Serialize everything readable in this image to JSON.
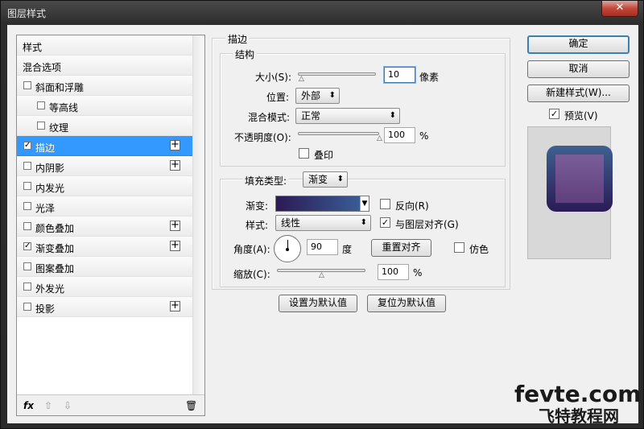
{
  "window": {
    "title": "图层样式",
    "close": "✕"
  },
  "styles_list": {
    "header": "样式",
    "items": [
      {
        "label": "混合选项",
        "checkbox": false,
        "checked": false,
        "plus": false,
        "indent": 0,
        "selected": false
      },
      {
        "label": "斜面和浮雕",
        "checkbox": true,
        "checked": false,
        "plus": false,
        "indent": 0,
        "selected": false
      },
      {
        "label": "等高线",
        "checkbox": true,
        "checked": false,
        "plus": false,
        "indent": 1,
        "selected": false
      },
      {
        "label": "纹理",
        "checkbox": true,
        "checked": false,
        "plus": false,
        "indent": 1,
        "selected": false
      },
      {
        "label": "描边",
        "checkbox": true,
        "checked": true,
        "plus": true,
        "indent": 0,
        "selected": true
      },
      {
        "label": "内阴影",
        "checkbox": true,
        "checked": false,
        "plus": true,
        "indent": 0,
        "selected": false
      },
      {
        "label": "内发光",
        "checkbox": true,
        "checked": false,
        "plus": false,
        "indent": 0,
        "selected": false
      },
      {
        "label": "光泽",
        "checkbox": true,
        "checked": false,
        "plus": false,
        "indent": 0,
        "selected": false
      },
      {
        "label": "颜色叠加",
        "checkbox": true,
        "checked": false,
        "plus": true,
        "indent": 0,
        "selected": false
      },
      {
        "label": "渐变叠加",
        "checkbox": true,
        "checked": true,
        "plus": true,
        "indent": 0,
        "selected": false
      },
      {
        "label": "图案叠加",
        "checkbox": true,
        "checked": false,
        "plus": false,
        "indent": 0,
        "selected": false
      },
      {
        "label": "外发光",
        "checkbox": true,
        "checked": false,
        "plus": false,
        "indent": 0,
        "selected": false
      },
      {
        "label": "投影",
        "checkbox": true,
        "checked": false,
        "plus": true,
        "indent": 0,
        "selected": false
      }
    ],
    "footer": {
      "fx": "fx",
      "up": "⇧",
      "down": "⇩",
      "trash": "🗑"
    }
  },
  "stroke": {
    "title": "描边",
    "structure": {
      "title": "结构",
      "size_label": "大小(S):",
      "size_value": "10",
      "size_unit": "像素",
      "size_level": 0.04,
      "position_label": "位置:",
      "position_value": "外部",
      "blend_label": "混合模式:",
      "blend_value": "正常",
      "opacity_label": "不透明度(O):",
      "opacity_value": "100",
      "opacity_unit": "%",
      "opacity_level": 1.0,
      "overprint_label": "叠印",
      "overprint_checked": false
    },
    "fill": {
      "type_label": "填充类型:",
      "type_value": "渐变",
      "gradient_label": "渐变:",
      "gradient_colors": [
        "#2b1a55",
        "#3a5c94"
      ],
      "reverse_label": "反向(R)",
      "reverse_checked": false,
      "style_label": "样式:",
      "style_value": "线性",
      "align_label": "与图层对齐(G)",
      "align_checked": true,
      "angle_label": "角度(A):",
      "angle_value": "90",
      "angle_unit": "度",
      "reset_align": "重置对齐",
      "dither_label": "仿色",
      "dither_checked": false,
      "scale_label": "缩放(C):",
      "scale_value": "100",
      "scale_unit": "%",
      "scale_level": 0.5
    },
    "make_default": "设置为默认值",
    "reset_default": "复位为默认值"
  },
  "buttons": {
    "ok": "确定",
    "cancel": "取消",
    "new_style": "新建样式(W)...",
    "preview_label": "预览(V)",
    "preview_checked": true
  },
  "watermark": {
    "line1": "fevte.com",
    "line2": "飞特教程网"
  },
  "colors": {
    "selection": "#3399ff",
    "preview_outer": "#3e6090",
    "preview_inner": "#7a5e99"
  }
}
